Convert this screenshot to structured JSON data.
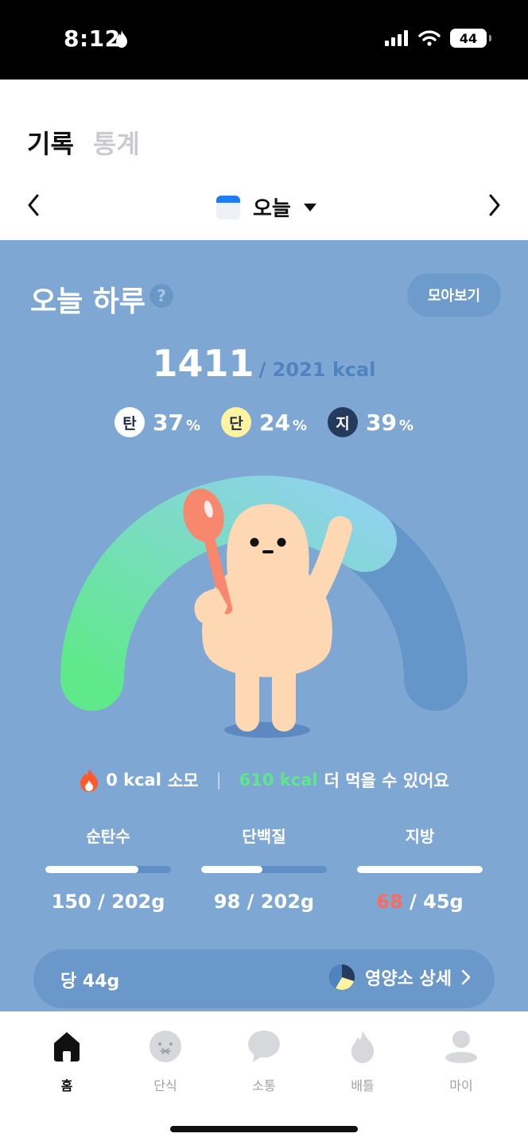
{
  "status_bar": {
    "time": "8:12",
    "battery": "44"
  },
  "header": {
    "tabs": [
      {
        "label": "기록",
        "active": true
      },
      {
        "label": "통계",
        "active": false
      }
    ],
    "date_label": "오늘"
  },
  "summary": {
    "title": "오늘 하루",
    "help_glyph": "?",
    "collect_button": "모아보기",
    "kcal_eaten": "1411",
    "kcal_goal_text": "/ 2021 kcal",
    "ratios": [
      {
        "badge": "탄",
        "value": "37",
        "unit": "%"
      },
      {
        "badge": "단",
        "value": "24",
        "unit": "%"
      },
      {
        "badge": "지",
        "value": "39",
        "unit": "%"
      }
    ],
    "gauge_progress_fraction": 0.7,
    "burn_value": "0 kcal",
    "burn_label": "소모",
    "separator": "|",
    "remain_value": "610 kcal",
    "remain_label": "더 먹을 수 있어요"
  },
  "macros": [
    {
      "name": "순탄수",
      "current": "150",
      "rest": " / 202g",
      "fill_fraction": 0.74,
      "over": false
    },
    {
      "name": "단백질",
      "current": "98",
      "rest": " / 202g",
      "fill_fraction": 0.49,
      "over": false
    },
    {
      "name": "지방",
      "current": "68",
      "rest": " / 45g",
      "fill_fraction": 1.0,
      "over": true
    }
  ],
  "sugar": {
    "label": "당 44g",
    "detail_link": "영양소 상세"
  },
  "bottom_nav": [
    {
      "label": "홈",
      "icon": "home-icon",
      "active": true
    },
    {
      "label": "단식",
      "icon": "fasting-face-icon",
      "active": false
    },
    {
      "label": "소통",
      "icon": "chat-bubble-icon",
      "active": false
    },
    {
      "label": "배틀",
      "icon": "flame-icon",
      "active": false
    },
    {
      "label": "마이",
      "icon": "person-icon",
      "active": false
    }
  ],
  "colors": {
    "panel": "#7ea8d3",
    "gauge_start": "#5fe98a",
    "gauge_end": "#8fd2ec",
    "gauge_track": "#6496c9",
    "over": "#ff6a5f"
  }
}
